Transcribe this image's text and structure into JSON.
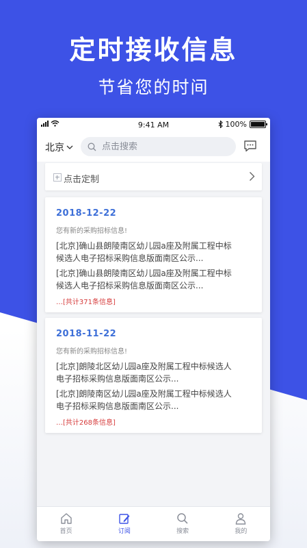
{
  "hero": {
    "title": "定时接收信息",
    "subtitle": "节省您的时间"
  },
  "status_bar": {
    "time": "9:41 AM",
    "battery": "100%"
  },
  "search_bar": {
    "city": "北京",
    "placeholder": "点击搜索"
  },
  "customize": {
    "label": "点击定制"
  },
  "cards": [
    {
      "date": "2018-12-22",
      "notice": "您有新的采购招标信息!",
      "items": [
        [
          "[北京]确山县朗陵南区幼儿园a座及附属工程中标",
          "候选人电子招标采购信息版面南区公示..."
        ],
        [
          "[北京]确山县朗陵南区幼儿园a座及附属工程中标",
          "候选人电子招标采购信息版面南区公示..."
        ]
      ],
      "total": "…[共计371条信息]"
    },
    {
      "date": "2018-11-22",
      "notice": "您有新的采购招标信息!",
      "items": [
        [
          "[北京]朗陵北区幼儿园a座及附属工程中标候选人",
          "电子招标采购信息版面南区公示..."
        ],
        [
          "[北京]朗陵南区幼儿园a座及附属工程中标候选人",
          "电子招标采购信息版面南区公示..."
        ]
      ],
      "total": "…[共计268条信息]"
    }
  ],
  "tabs": [
    {
      "label": "首页",
      "icon": "home-icon"
    },
    {
      "label": "订阅",
      "icon": "subscribe-icon"
    },
    {
      "label": "搜索",
      "icon": "search-icon"
    },
    {
      "label": "我的",
      "icon": "user-icon"
    }
  ],
  "colors": {
    "accent": "#3d52e6",
    "date": "#3d6fd8",
    "total": "#d63b3b"
  }
}
